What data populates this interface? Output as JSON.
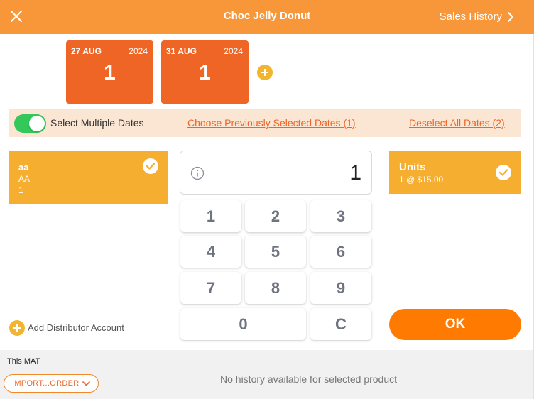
{
  "header": {
    "title": "Choc Jelly Donut",
    "history_label": "Sales History",
    "close_icon": "close-icon",
    "chevron_icon": "chevron-right-icon",
    "bg_color": "#f7973a"
  },
  "dates": [
    {
      "day_month": "27 AUG",
      "year": "2024",
      "qty": "1"
    },
    {
      "day_month": "31 AUG",
      "year": "2024",
      "qty": "1"
    }
  ],
  "date_controls": {
    "toggle_label": "Select Multiple Dates",
    "toggle_on": true,
    "choose_previous": "Choose Previously Selected Dates (1)",
    "deselect_all": "Deselect All Dates (2)"
  },
  "account": {
    "line1": "aa",
    "line2": "AA",
    "line3": "1",
    "selected": true
  },
  "add_distributor": "Add Distributor Account",
  "keypad": {
    "display_value": "1",
    "keys": [
      "1",
      "2",
      "3",
      "4",
      "5",
      "6",
      "7",
      "8",
      "9",
      "0",
      "C"
    ]
  },
  "units": {
    "label": "Units",
    "detail": "1 @ $15.00",
    "selected": true
  },
  "ok_label": "OK",
  "bottom": {
    "mat_label": "This MAT",
    "import_label": "IMPORT...ORDER",
    "no_history": "No history available for selected product"
  },
  "colors": {
    "accent": "#ee6526",
    "card": "#f6ae31",
    "ok": "#ff7a00",
    "toggle": "#34c759"
  }
}
